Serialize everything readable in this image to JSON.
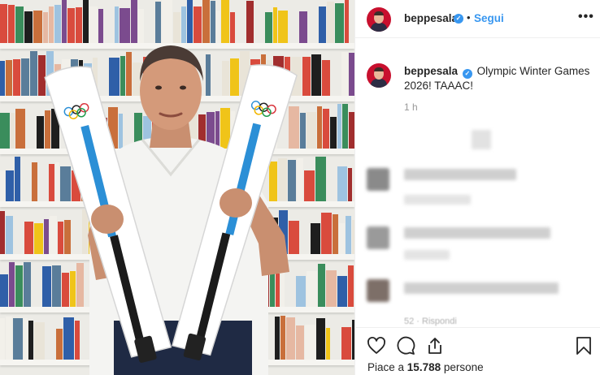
{
  "post": {
    "username": "beppesala",
    "follow_label": "Segui",
    "dot": "•",
    "more_label": "•••",
    "caption_username": "beppesala",
    "caption": "Olympic Winter Games 2026! TAAAC!",
    "time_ago": "1 h",
    "likes_prefix": "Piace a",
    "likes_count": "15.788",
    "likes_suffix": "persone",
    "partial_text": "52 · Rispondi"
  },
  "icons": {
    "verified": "verified-badge-icon",
    "like": "heart-icon",
    "comment": "comment-bubble-icon",
    "share": "share-icon",
    "save": "bookmark-icon"
  },
  "colors": {
    "link_blue": "#3897f0",
    "text": "#262626",
    "muted": "#999999",
    "avatar_red": "#c8102e",
    "ski_stripe": "#2b8fd6"
  }
}
